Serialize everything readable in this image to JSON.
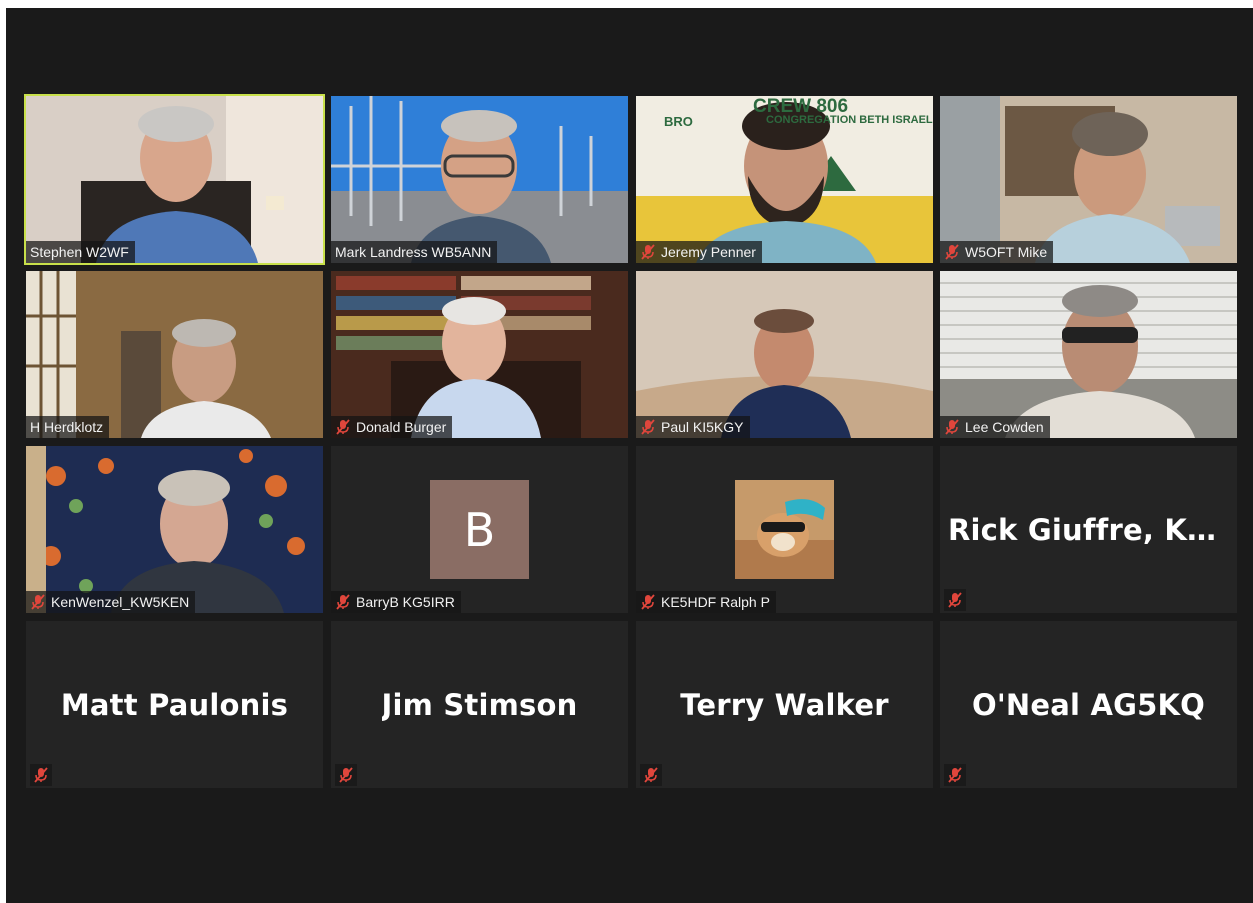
{
  "participants": [
    {
      "name": "Stephen W2WF",
      "muted": false,
      "active": true
    },
    {
      "name": "Mark Landress WB5ANN",
      "muted": false
    },
    {
      "name": "Jeremy Penner",
      "muted": true
    },
    {
      "name": "W5OFT  Mike",
      "muted": true
    },
    {
      "name": "H Herdklotz",
      "muted": false
    },
    {
      "name": "Donald Burger",
      "muted": true
    },
    {
      "name": "Paul KI5KGY",
      "muted": true
    },
    {
      "name": "Lee Cowden",
      "muted": true
    },
    {
      "name": "KenWenzel_KW5KEN",
      "muted": true
    },
    {
      "name": "BarryB KG5IRR",
      "muted": true,
      "avatar_letter": "B"
    },
    {
      "name": "KE5HDF Ralph P",
      "muted": true
    },
    {
      "display_name": "Rick Giuffre, KE...",
      "muted": true
    },
    {
      "display_name": "Matt Paulonis",
      "muted": true
    },
    {
      "display_name": "Jim Stimson",
      "muted": true
    },
    {
      "display_name": "Terry Walker",
      "muted": true
    },
    {
      "display_name": "O'Neal AG5KQ",
      "muted": true
    }
  ],
  "banner": {
    "line1": "CREW 806",
    "line2": "BRO",
    "line3": "CONGREGATION BETH ISRAEL"
  },
  "colors": {
    "background": "#1a1a1a",
    "tile": "#242424",
    "active_speaker": "#c8e04a",
    "mute_red": "#e0463c"
  },
  "icons": {
    "mute": "microphone-muted-icon"
  }
}
